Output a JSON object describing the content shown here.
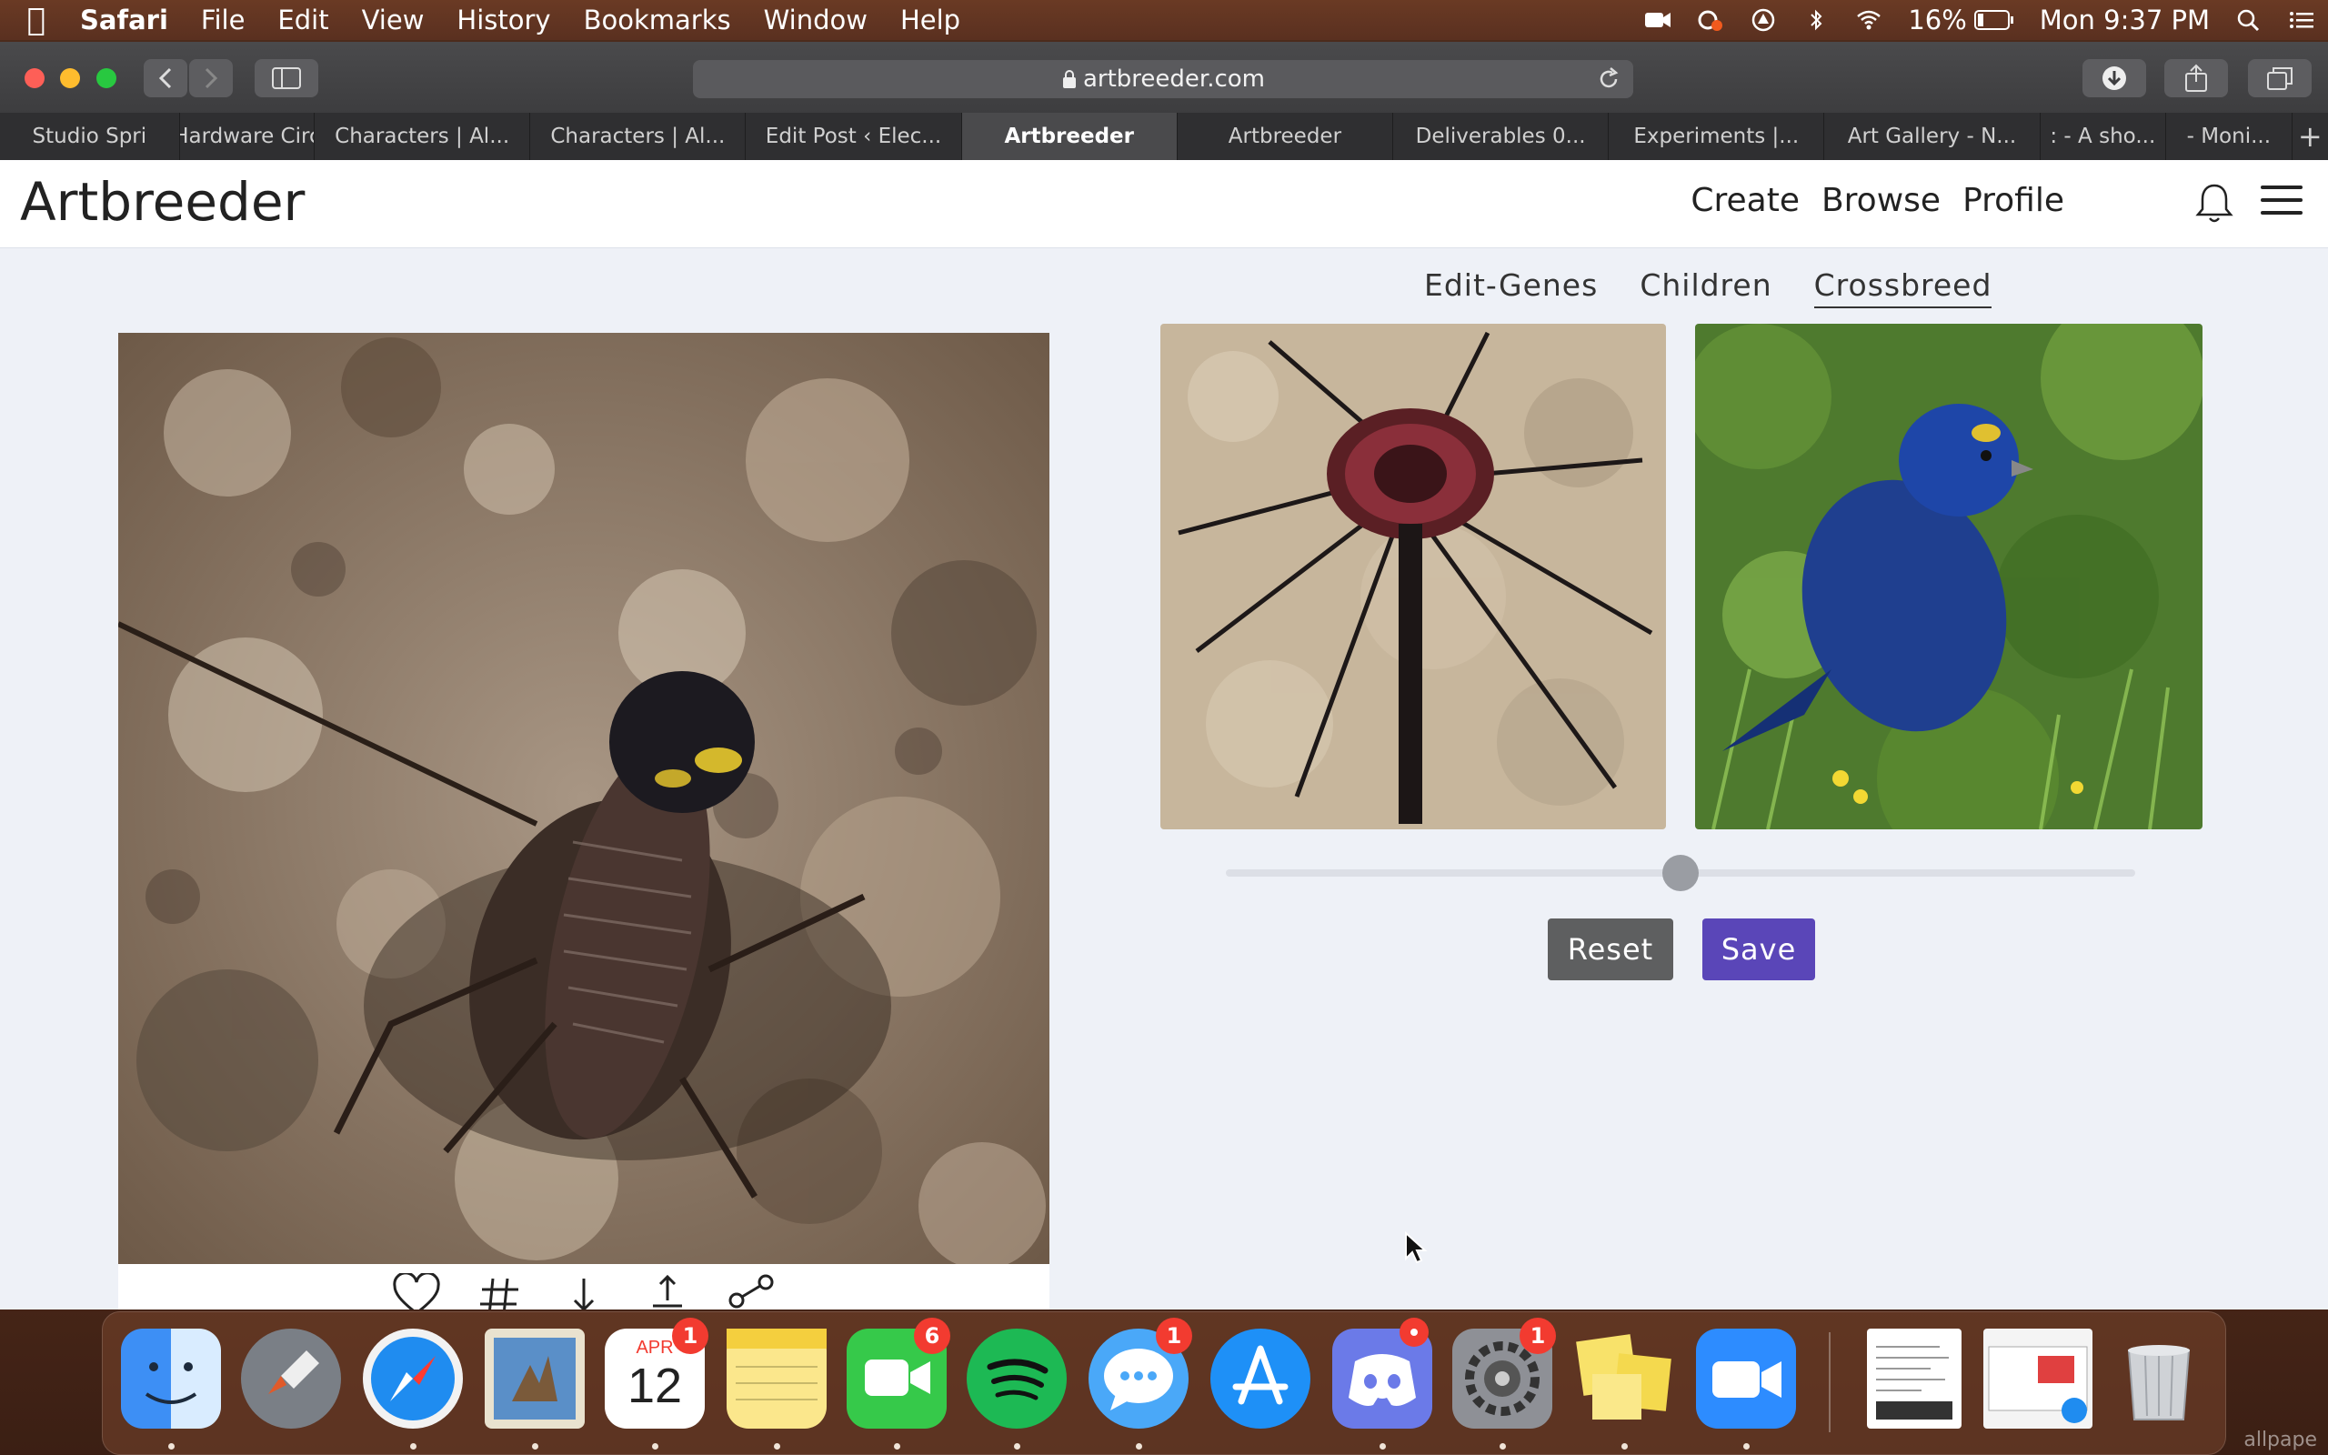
{
  "menubar": {
    "app_name": "Safari",
    "items": [
      "File",
      "Edit",
      "View",
      "History",
      "Bookmarks",
      "Window",
      "Help"
    ],
    "battery": "16%",
    "clock": "Mon 9:37 PM"
  },
  "browser": {
    "url": "artbreeder.com",
    "tabs": [
      {
        "label": "Studio Spri"
      },
      {
        "label": "Hardware Circ"
      },
      {
        "label": "Characters | Al..."
      },
      {
        "label": "Characters | Al..."
      },
      {
        "label": "Edit Post ‹ Elec..."
      },
      {
        "label": "Artbreeder"
      },
      {
        "label": "Artbreeder"
      },
      {
        "label": "Deliverables 0..."
      },
      {
        "label": "Experiments |..."
      },
      {
        "label": "Art Gallery - N..."
      },
      {
        "label": ": - A sho..."
      },
      {
        "label": "- Moni..."
      }
    ],
    "new_tab": "+"
  },
  "site": {
    "logo": "Artbreeder",
    "nav": {
      "create": "Create",
      "browse": "Browse",
      "profile": "Profile"
    }
  },
  "subtabs": {
    "edit_genes": "Edit-Genes",
    "children": "Children",
    "crossbreed": "Crossbreed"
  },
  "crossbreed": {
    "slider_value": 0.5,
    "reset_label": "Reset",
    "save_label": "Save"
  },
  "dock": {
    "calendar_month": "APR",
    "calendar_day": "12",
    "calendar_badge": "1",
    "facetime_badge": "6",
    "messages_badge": "1",
    "prefs_badge": "1"
  },
  "watermark": "allpape"
}
